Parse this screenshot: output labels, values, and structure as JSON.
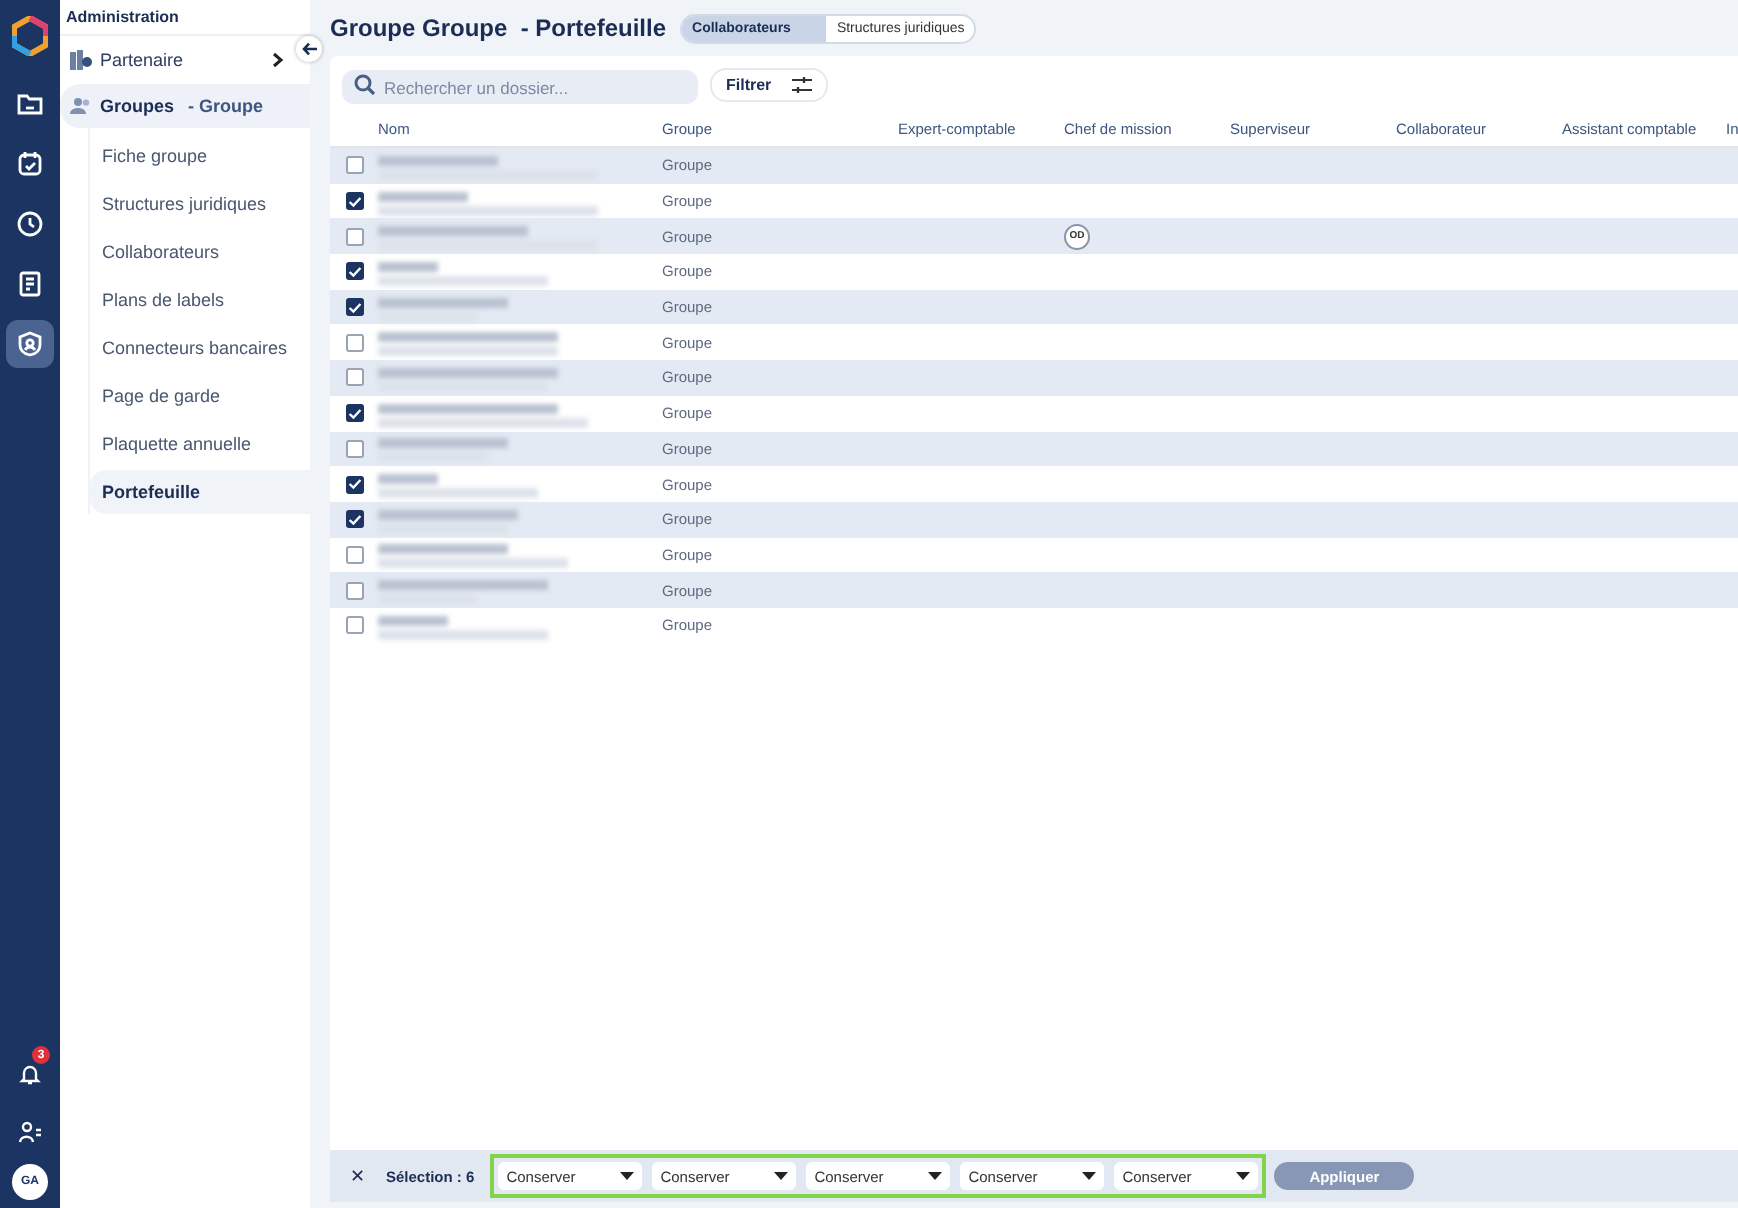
{
  "nav_rail": {
    "items": [
      {
        "selected": false
      },
      {
        "selected": false
      },
      {
        "selected": false
      },
      {
        "selected": false
      },
      {
        "selected": true
      }
    ],
    "notifications_badge": "3",
    "avatar": "GA"
  },
  "sidebar": {
    "title": "Administration",
    "partner": "Partenaire",
    "group": {
      "label": "Groupes",
      "suffix": "- Groupe"
    },
    "items": [
      {
        "label": "Fiche groupe",
        "selected": false
      },
      {
        "label": "Structures juridiques",
        "selected": false
      },
      {
        "label": "Collaborateurs",
        "selected": false
      },
      {
        "label": "Plans de labels",
        "selected": false
      },
      {
        "label": "Connecteurs bancaires",
        "selected": false
      },
      {
        "label": "Page de garde",
        "selected": false
      },
      {
        "label": "Plaquette annuelle",
        "selected": false
      },
      {
        "label": "Portefeuille",
        "selected": true
      }
    ]
  },
  "page": {
    "title": "Groupe Groupe  - Portefeuille",
    "tabs": [
      {
        "label": "Collaborateurs",
        "selected": true
      },
      {
        "label": "Structures juridiques",
        "selected": false
      }
    ]
  },
  "search": {
    "placeholder": "Rechercher un dossier..."
  },
  "filter_button": "Filtrer",
  "table": {
    "columns": [
      "Nom",
      "Groupe",
      "Expert-comptable",
      "Chef de mission",
      "Superviseur",
      "Collaborateur",
      "Assistant comptable",
      "In"
    ],
    "rows": [
      {
        "checked": false,
        "groupe": "Groupe"
      },
      {
        "checked": true,
        "groupe": "Groupe"
      },
      {
        "checked": false,
        "groupe": "Groupe",
        "chef_de_mission": "OD"
      },
      {
        "checked": true,
        "groupe": "Groupe"
      },
      {
        "checked": true,
        "groupe": "Groupe"
      },
      {
        "checked": false,
        "groupe": "Groupe"
      },
      {
        "checked": false,
        "groupe": "Groupe"
      },
      {
        "checked": true,
        "groupe": "Groupe"
      },
      {
        "checked": false,
        "groupe": "Groupe"
      },
      {
        "checked": true,
        "groupe": "Groupe"
      },
      {
        "checked": true,
        "groupe": "Groupe"
      },
      {
        "checked": false,
        "groupe": "Groupe"
      },
      {
        "checked": false,
        "groupe": "Groupe"
      },
      {
        "checked": false,
        "groupe": "Groupe"
      }
    ]
  },
  "bulk_bar": {
    "close": "✕",
    "selection": "Sélection : 6",
    "selects": [
      "Conserver",
      "Conserver",
      "Conserver",
      "Conserver",
      "Conserver"
    ],
    "apply": "Appliquer"
  }
}
